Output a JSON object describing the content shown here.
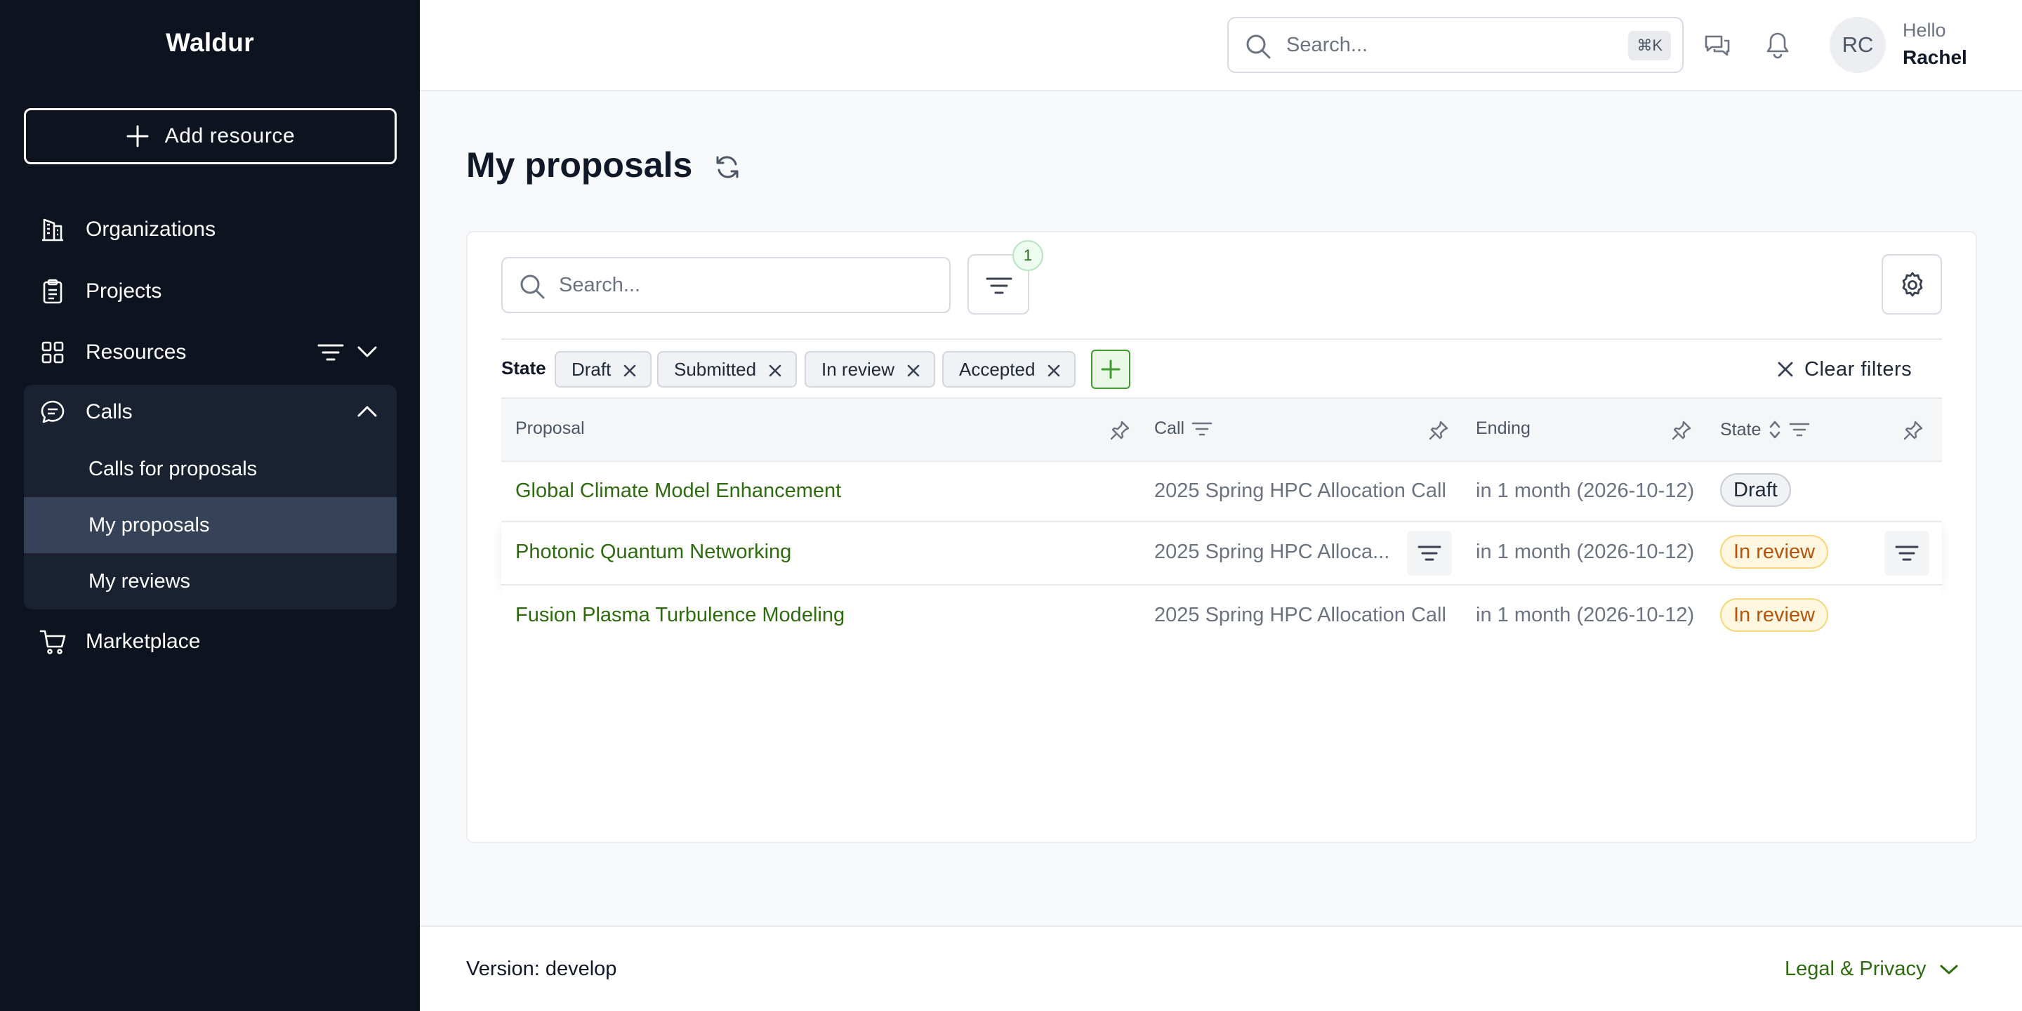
{
  "sidebar": {
    "brand": "Waldur",
    "add_resource_label": "Add resource",
    "items": {
      "organizations": "Organizations",
      "projects": "Projects",
      "resources": "Resources",
      "calls": "Calls",
      "marketplace": "Marketplace"
    },
    "calls_sub": {
      "calls_for_proposals": "Calls for proposals",
      "my_proposals": "My proposals",
      "my_reviews": "My reviews"
    }
  },
  "header": {
    "search_placeholder": "Search...",
    "shortcut": "⌘K",
    "avatar_initials": "RC",
    "greeting": "Hello",
    "user_name": "Rachel"
  },
  "page": {
    "title": "My proposals"
  },
  "table": {
    "search_placeholder": "Search...",
    "filter_count": "1",
    "state_filter_label": "State",
    "state_chips": [
      "Draft",
      "Submitted",
      "In review",
      "Accepted"
    ],
    "clear_filters": "Clear filters",
    "columns": [
      "Proposal",
      "Call",
      "Ending",
      "State"
    ],
    "rows": [
      {
        "proposal": "Global Climate Model Enhancement",
        "call": "2025 Spring HPC Allocation Call",
        "ending": "in 1 month (2026-10-12)",
        "state": "Draft"
      },
      {
        "proposal": "Photonic Quantum Networking",
        "call": "2025 Spring HPC Alloca...",
        "ending": "in 1 month (2026-10-12)",
        "state": "In review"
      },
      {
        "proposal": "Fusion Plasma Turbulence Modeling",
        "call": "2025 Spring HPC Allocation Call",
        "ending": "in 1 month (2026-10-12)",
        "state": "In review"
      }
    ]
  },
  "footer": {
    "version": "Version: develop",
    "legal": "Legal & Privacy"
  },
  "colors": {
    "sidebar_bg": "#0e1320",
    "link_green": "#2e6b0f",
    "review_badge": "#b45309"
  }
}
